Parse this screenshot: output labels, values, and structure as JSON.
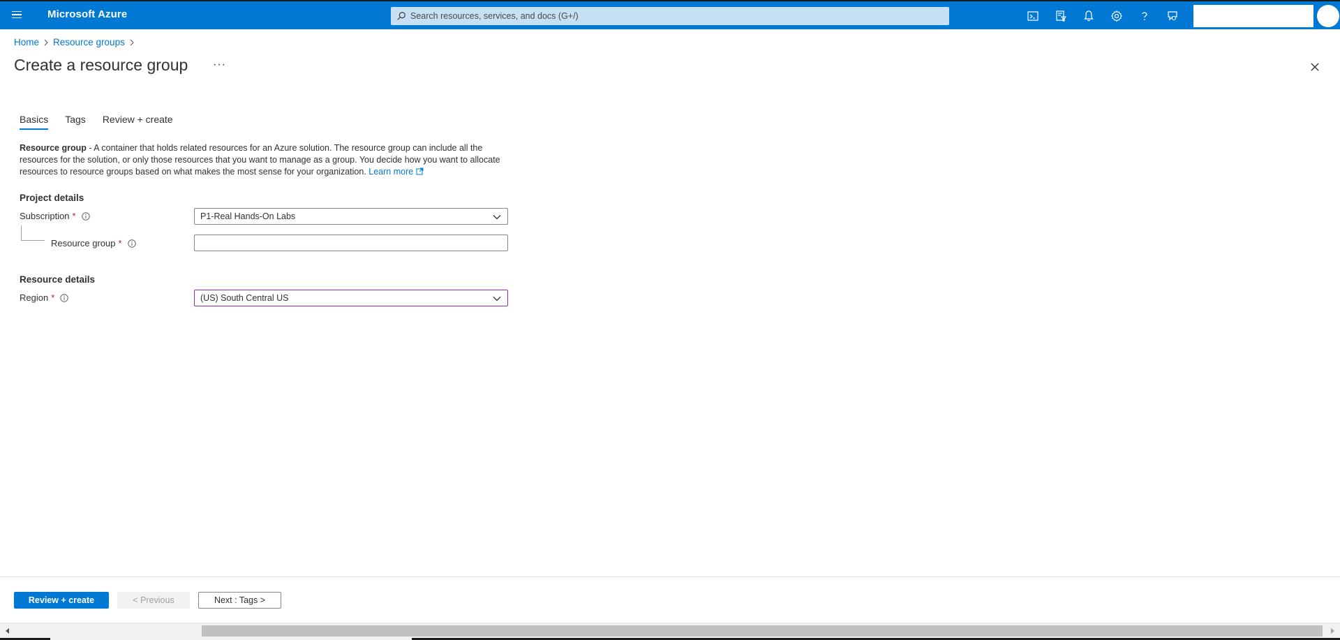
{
  "topbar": {
    "brand": "Microsoft Azure",
    "search_placeholder": "Search resources, services, and docs (G+/)",
    "icons": [
      "terminal-icon",
      "directory-filter-icon",
      "bell-icon",
      "gear-icon",
      "help-icon",
      "feedback-icon"
    ],
    "accent": "#0078d4"
  },
  "breadcrumb": {
    "items": [
      "Home",
      "Resource groups"
    ]
  },
  "page": {
    "title": "Create a resource group",
    "more": "···"
  },
  "tabs": [
    {
      "label": "Basics",
      "active": true
    },
    {
      "label": "Tags",
      "active": false
    },
    {
      "label": "Review + create",
      "active": false
    }
  ],
  "description": {
    "bold": "Resource group",
    "text": " - A container that holds related resources for an Azure solution. The resource group can include all the resources for the solution, or only those resources that you want to manage as a group. You decide how you want to allocate resources to resource groups based on what makes the most sense for your organization. ",
    "link": "Learn more"
  },
  "project_details": {
    "heading": "Project details",
    "subscription_label": "Subscription",
    "subscription_value": "P1-Real Hands-On Labs",
    "resource_group_label": "Resource group",
    "resource_group_value": "",
    "required_mark": "*"
  },
  "resource_details": {
    "heading": "Resource details",
    "region_label": "Region",
    "region_value": "(US) South Central US"
  },
  "footer": {
    "review_create": "Review + create",
    "previous": "< Previous",
    "next": "Next : Tags >"
  }
}
